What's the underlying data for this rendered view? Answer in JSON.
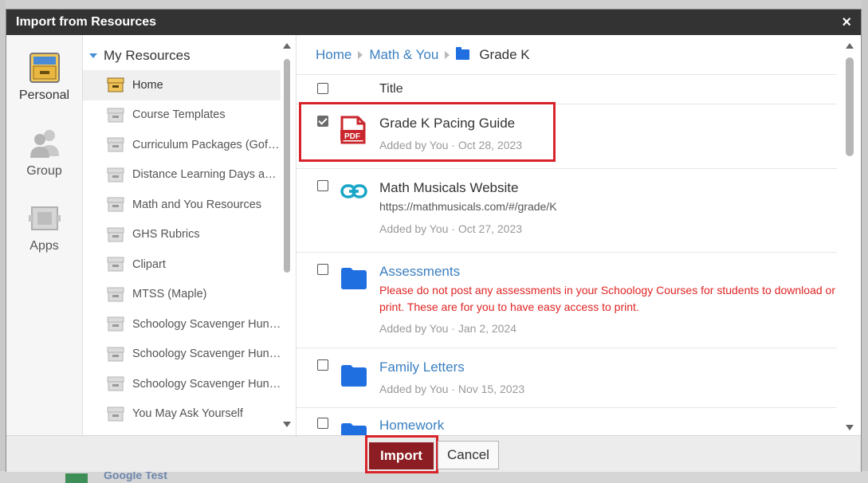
{
  "dialog": {
    "title": "Import from Resources",
    "close": "×"
  },
  "rail": [
    {
      "label": "Personal",
      "icon": "resource-box-icon"
    },
    {
      "label": "Group",
      "icon": "group-people-icon"
    },
    {
      "label": "Apps",
      "icon": "apps-icon"
    }
  ],
  "tree": {
    "header": "My Resources",
    "items": [
      "Home",
      "Course Templates",
      "Curriculum Packages (Gof…",
      "Distance Learning Days a…",
      "Math and You Resources",
      "GHS Rubrics",
      "Clipart",
      "MTSS (Maple)",
      "Schoology Scavenger Hun…",
      "Schoology Scavenger Hun…",
      "Schoology Scavenger Hun…",
      "You May Ask Yourself"
    ]
  },
  "breadcrumb": {
    "home": "Home",
    "parent": "Math & You",
    "current": "Grade K"
  },
  "columns": {
    "title": "Title"
  },
  "rows": [
    {
      "name": "Grade K Pacing Guide",
      "meta": "Added by You · Oct 28, 2023",
      "icon": "pdf-icon",
      "checked": true
    },
    {
      "name": "Math Musicals Website",
      "url": "https://mathmusicals.com/#/grade/K",
      "meta": "Added by You · Oct 27, 2023",
      "icon": "link-icon",
      "checked": false
    },
    {
      "name": "Assessments",
      "desc": "Please do not post any assessments in your Schoology Courses for students to download or print. These are for you to have easy access to print.",
      "meta": "Added by You · Jan 2, 2024",
      "icon": "folder-icon",
      "checked": false
    },
    {
      "name": "Family Letters",
      "meta": "Added by You · Nov 15, 2023",
      "icon": "folder-icon",
      "checked": false
    },
    {
      "name": "Homework",
      "icon": "folder-icon",
      "checked": false
    }
  ],
  "footer": {
    "import": "Import",
    "cancel": "Cancel"
  },
  "background": {
    "peek_text": "Google Test"
  },
  "colors": {
    "accent": "#8c1d22",
    "link": "#3a7fc1",
    "highlight": "#d8232a",
    "folder": "#1f6fe0",
    "warning": "#e02424"
  }
}
